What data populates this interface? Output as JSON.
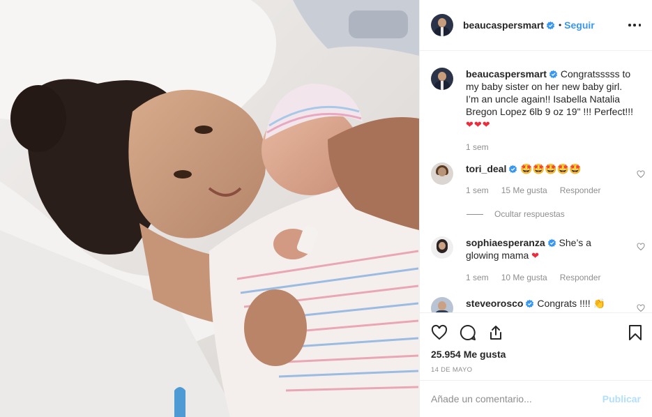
{
  "post": {
    "author": "beaucaspersmart",
    "follow_label": "Seguir",
    "dot": "•",
    "caption": {
      "username": "beaucaspersmart",
      "text": "Congratsssss to my baby sister on her new baby girl. I’m an uncle again!! Isabella Natalia Bregon Lopez 6lb 9 oz 19\" !!! Perfect!!!",
      "emoji": "❤❤❤",
      "time": "1 sem"
    },
    "comments": [
      {
        "username": "tori_deal",
        "text": "🤩🤩🤩🤩🤩",
        "time": "1 sem",
        "likes": "15 Me gusta",
        "reply": "Responder"
      },
      {
        "username": "sophiaesperanza",
        "text": "She’s a glowing mama",
        "emoji": "❤",
        "time": "1 sem",
        "likes": "10 Me gusta",
        "reply": "Responder"
      },
      {
        "username": "steveorosco",
        "text": "Congrats !!!! 👏"
      }
    ],
    "hide_replies_label": "Ocultar respuestas",
    "like_count": "25.954 Me gusta",
    "date": "14 DE MAYO",
    "comment_placeholder": "Añade un comentario...",
    "publish_label": "Publicar"
  },
  "icons": {
    "more": "more-options-icon",
    "heart": "heart-icon",
    "comment": "comment-icon",
    "share": "share-icon",
    "save": "bookmark-icon",
    "verified": "verified-badge-icon"
  },
  "colors": {
    "link_blue": "#3897f0",
    "publish_disabled": "#b2dffc",
    "text": "#262626",
    "muted": "#8e8e8e",
    "verified": "#3897f0",
    "heart_red": "#ed2b3a",
    "border": "#efefef"
  }
}
